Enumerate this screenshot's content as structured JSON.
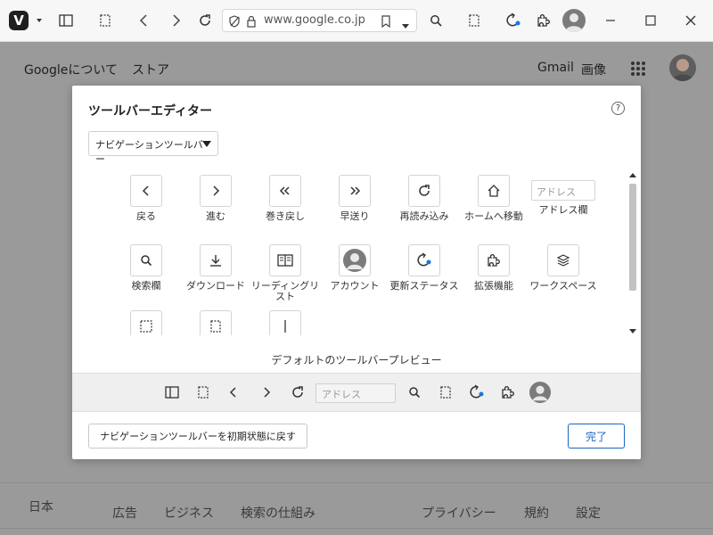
{
  "browser": {
    "address_url": "www.google.co.jp",
    "accent_color": "#1a73e8"
  },
  "page": {
    "top_left_links": [
      "Googleについて",
      "ストア"
    ],
    "top_right_links": [
      "Gmail",
      "画像"
    ],
    "country": "日本",
    "footer_left": [
      "広告",
      "ビジネス",
      "検索の仕組み"
    ],
    "footer_right": [
      "プライバシー",
      "規約",
      "設定"
    ]
  },
  "dialog": {
    "title": "ツールバーエディター",
    "help_icon": "?",
    "toolbar_select": "ナビゲーションツールバー",
    "tools": [
      {
        "label": "戻る",
        "icon": "back-icon"
      },
      {
        "label": "進む",
        "icon": "forward-icon"
      },
      {
        "label": "巻き戻し",
        "icon": "rewind-icon"
      },
      {
        "label": "早送り",
        "icon": "fast-forward-icon"
      },
      {
        "label": "再読み込み",
        "icon": "reload-icon"
      },
      {
        "label": "ホームへ移動",
        "icon": "home-icon"
      },
      {
        "label": "アドレス欄",
        "icon": "address-field",
        "placeholder": "アドレス"
      },
      {
        "label": "検索欄",
        "icon": "search-icon"
      },
      {
        "label": "ダウンロード",
        "icon": "download-icon"
      },
      {
        "label": "リーディングリスト",
        "icon": "reading-list-icon"
      },
      {
        "label": "アカウント",
        "icon": "account-icon"
      },
      {
        "label": "更新ステータス",
        "icon": "update-status-icon"
      },
      {
        "label": "拡張機能",
        "icon": "extensions-icon"
      },
      {
        "label": "ワークスペース",
        "icon": "workspaces-icon"
      },
      {
        "label": "",
        "icon": "flexible-space-icon"
      },
      {
        "label": "",
        "icon": "fixed-space-icon"
      },
      {
        "label": "",
        "icon": "divider-icon"
      }
    ],
    "preview_label": "デフォルトのツールバープレビュー",
    "preview_address_placeholder": "アドレス",
    "reset_button": "ナビゲーションツールバーを初期状態に戻す",
    "done_button": "完了"
  }
}
